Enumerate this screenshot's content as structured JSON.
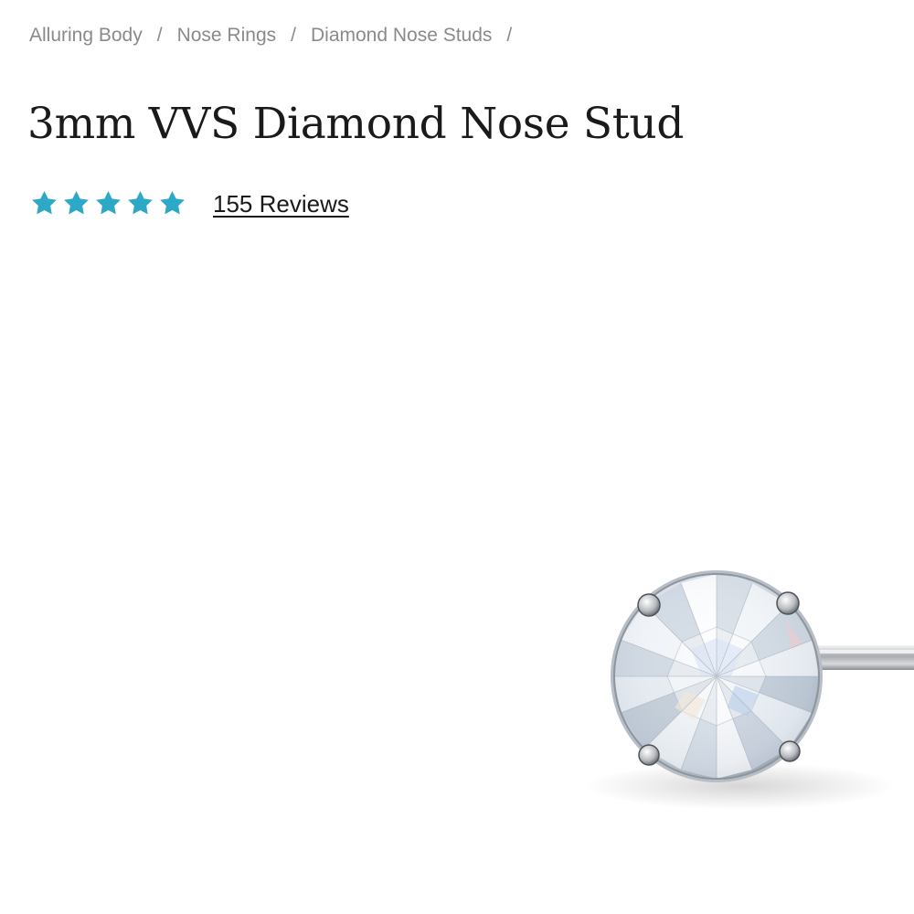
{
  "breadcrumb": {
    "items": [
      {
        "label": "Alluring Body"
      },
      {
        "label": "Nose Rings"
      },
      {
        "label": "Diamond Nose Studs"
      }
    ],
    "separator": "/"
  },
  "product": {
    "title": "3mm VVS Diamond Nose Stud",
    "rating": {
      "stars": 5,
      "max_stars": 5,
      "reviews_label": "155 Reviews",
      "star_color": "#2ea8c7"
    },
    "image": {
      "icon": "diamond-stud-photo"
    }
  }
}
